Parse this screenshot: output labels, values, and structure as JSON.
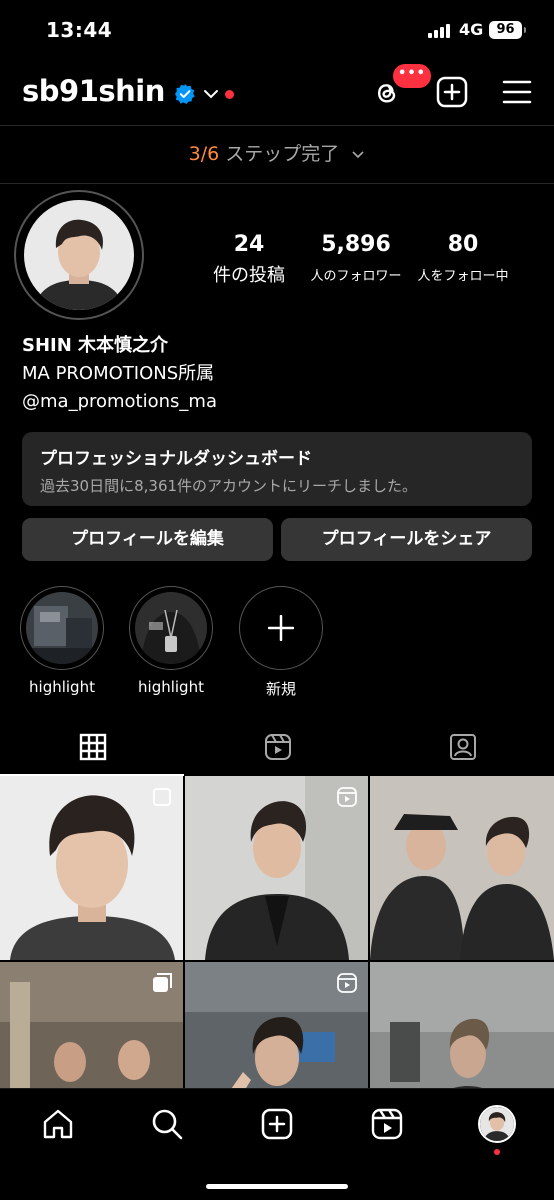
{
  "status": {
    "time": "13:44",
    "network": "4G",
    "battery": "96"
  },
  "header": {
    "username": "sb91shin",
    "threads_badge": "•••"
  },
  "steps": {
    "progress": "3/6",
    "label": "ステップ完了"
  },
  "stats": {
    "posts": {
      "value": "24",
      "label": "件の投稿"
    },
    "followers": {
      "value": "5,896",
      "label": "人のフォロワー"
    },
    "following": {
      "value": "80",
      "label": "人をフォロー中"
    }
  },
  "bio": {
    "name": "SHIN 木本慎之介",
    "line2": "MA PROMOTIONS所属",
    "line3": "@ma_promotions_ma"
  },
  "dashboard": {
    "title": "プロフェッショナルダッシュボード",
    "subtitle": "過去30日間に8,361件のアカウントにリーチしました。"
  },
  "buttons": {
    "edit": "プロフィールを編集",
    "share": "プロフィールをシェア"
  },
  "highlights": [
    {
      "label": "highlight"
    },
    {
      "label": "highlight"
    },
    {
      "label": "新規"
    }
  ],
  "colors": {
    "accent_orange": "#ff8a3d",
    "notification_red": "#ff3040",
    "verified_blue": "#0095f6"
  },
  "icons": {
    "tabs": [
      "grid-icon",
      "reels-icon",
      "tagged-icon"
    ],
    "nav": [
      "home-icon",
      "search-icon",
      "create-icon",
      "reels-icon",
      "profile-avatar"
    ]
  }
}
